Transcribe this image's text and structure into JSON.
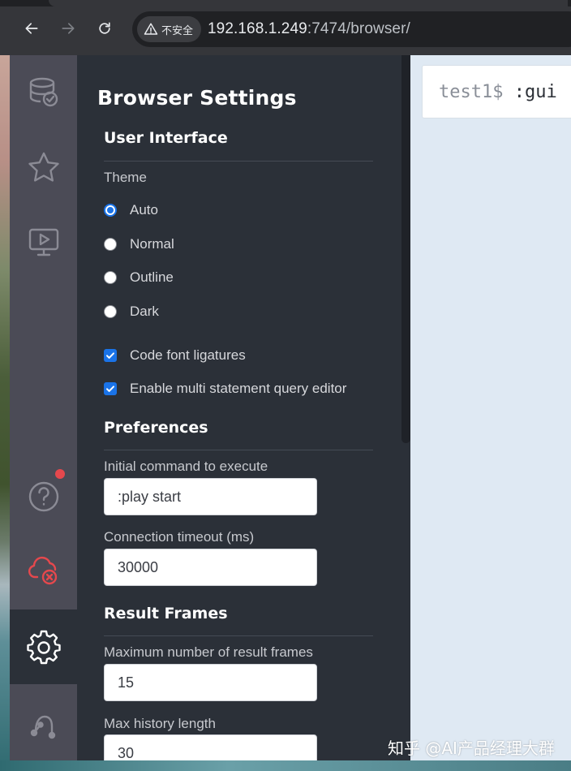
{
  "browser": {
    "security_label": "不安全",
    "url_host": "192.168.1.249",
    "url_rest": ":7474/browser/"
  },
  "sidebar": {
    "icons": [
      "database-icon",
      "star-icon",
      "play-guide-icon",
      "help-icon",
      "disconnected-icon",
      "gear-icon",
      "neo4j-logo-icon"
    ],
    "active": "gear-icon",
    "notification_color": "#e5484d"
  },
  "drawer": {
    "title": "Browser Settings",
    "user_interface": {
      "heading": "User Interface",
      "theme_label": "Theme",
      "themes": [
        "Auto",
        "Normal",
        "Outline",
        "Dark"
      ],
      "selected_theme": "Auto",
      "ligatures_label": "Code font ligatures",
      "ligatures_checked": true,
      "multi_statement_label": "Enable multi statement query editor",
      "multi_statement_checked": true
    },
    "preferences": {
      "heading": "Preferences",
      "initial_command_label": "Initial command to execute",
      "initial_command_value": ":play start",
      "timeout_label": "Connection timeout (ms)",
      "timeout_value": "30000"
    },
    "result_frames": {
      "heading": "Result Frames",
      "max_frames_label": "Maximum number of result frames",
      "max_frames_value": "15",
      "max_history_label": "Max history length",
      "max_history_value": "30"
    }
  },
  "editor": {
    "prompt": "test1$",
    "command": " :gui"
  },
  "watermark": "知乎 @AI产品经理大群",
  "colors": {
    "accent": "#1a73e8",
    "drawer_bg": "#2b3038",
    "iconbar_bg": "#4b4b56",
    "main_bg": "#dfe9f3"
  }
}
